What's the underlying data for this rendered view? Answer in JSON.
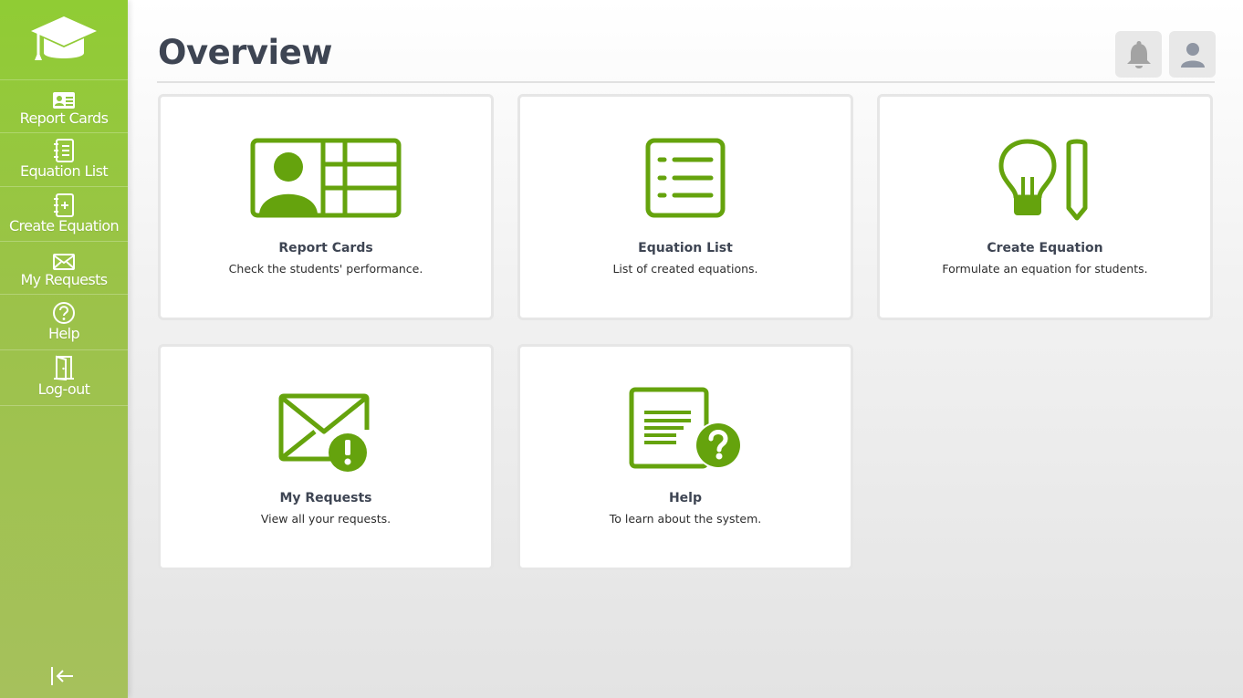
{
  "theme": {
    "accent": "#65a30d",
    "sidebar_top": "#90cc34",
    "sidebar_bottom": "#a6c15c",
    "text": "#3e4553"
  },
  "sidebar": {
    "logo_icon": "graduation-cap-icon",
    "items": [
      {
        "label": "Report Cards",
        "icon": "id-card-icon"
      },
      {
        "label": "Equation List",
        "icon": "notebook-list-icon"
      },
      {
        "label": "Create Equation",
        "icon": "notebook-plus-icon"
      },
      {
        "label": "My Requests",
        "icon": "envelope-icon"
      },
      {
        "label": "Help",
        "icon": "question-circle-icon"
      },
      {
        "label": "Log-out",
        "icon": "door-icon"
      }
    ],
    "collapse_icon": "collapse-left-icon"
  },
  "header": {
    "title": "Overview",
    "notification_icon": "bell-icon",
    "profile_icon": "user-icon"
  },
  "cards": [
    {
      "title": "Report Cards",
      "description": "Check the students' performance.",
      "icon": "report-card-icon"
    },
    {
      "title": "Equation List",
      "description": "List of created equations.",
      "icon": "list-icon"
    },
    {
      "title": "Create Equation",
      "description": "Formulate an equation for students.",
      "icon": "lightbulb-pencil-icon"
    },
    {
      "title": "My Requests",
      "description": "View all your requests.",
      "icon": "envelope-alert-icon"
    },
    {
      "title": "Help",
      "description": "To learn about the system.",
      "icon": "document-question-icon"
    }
  ]
}
